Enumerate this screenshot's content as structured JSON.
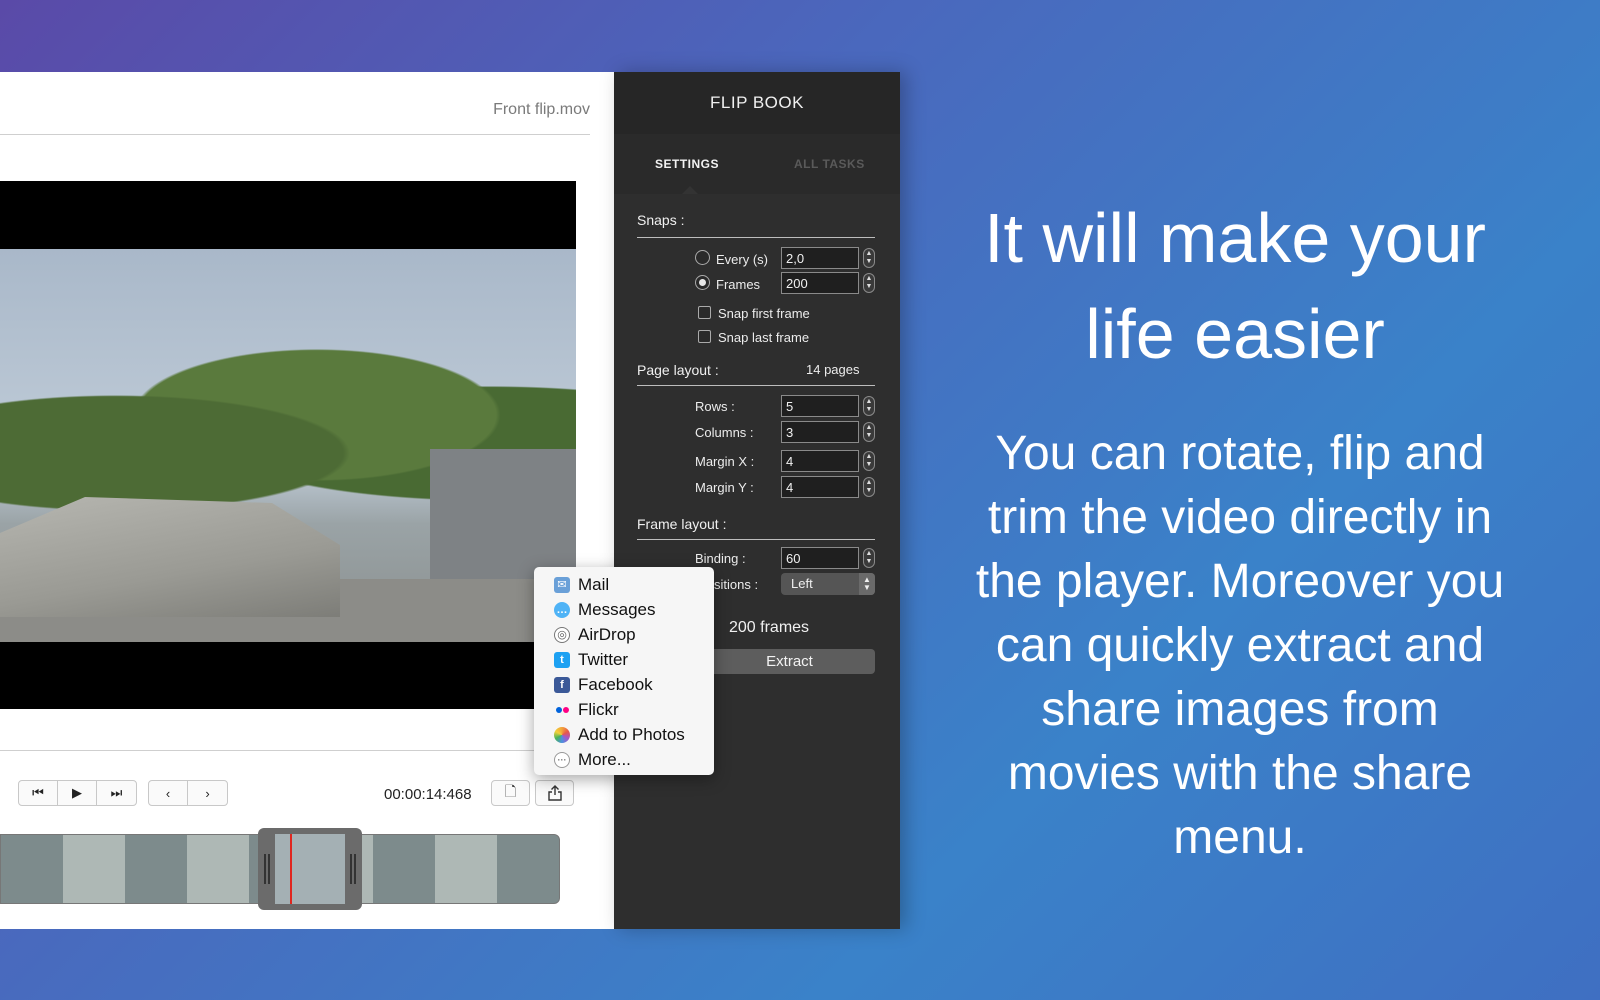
{
  "player": {
    "file_name": "Front flip.mov",
    "timecode": "00:00:14:468"
  },
  "share_menu": {
    "items": [
      {
        "label": "Mail",
        "icon": "mail-icon",
        "color": "#6aa0d8"
      },
      {
        "label": "Messages",
        "icon": "messages-icon",
        "color": "#4fb3f6"
      },
      {
        "label": "AirDrop",
        "icon": "airdrop-icon",
        "color": "#777777"
      },
      {
        "label": "Twitter",
        "icon": "twitter-icon",
        "color": "#1da1f2"
      },
      {
        "label": "Facebook",
        "icon": "facebook-icon",
        "color": "#3b5998"
      },
      {
        "label": "Flickr",
        "icon": "flickr-icon",
        "color": "#ff0084"
      },
      {
        "label": "Add to Photos",
        "icon": "photos-icon",
        "color": "#f2a33a"
      },
      {
        "label": "More...",
        "icon": "more-icon",
        "color": "#999999"
      }
    ]
  },
  "flipbook": {
    "title": "FLIP BOOK",
    "tabs": {
      "settings": "SETTINGS",
      "all_tasks": "ALL TASKS"
    },
    "snaps": {
      "label": "Snaps :",
      "every_label": "Every (s)",
      "every_value": "2,0",
      "frames_label": "Frames",
      "frames_value": "200",
      "snap_first": "Snap first frame",
      "snap_last": "Snap last frame"
    },
    "page_layout": {
      "label": "Page layout :",
      "pages": "14 pages",
      "rows_label": "Rows :",
      "rows": "5",
      "columns_label": "Columns :",
      "columns": "3",
      "margin_x_label": "Margin X :",
      "margin_x": "4",
      "margin_y_label": "Margin Y :",
      "margin_y": "4"
    },
    "frame_layout": {
      "label": "Frame layout :",
      "binding_label": "Binding :",
      "binding": "60",
      "positions_label": "sitions :",
      "positions": "Left"
    },
    "frames_count": "200 frames",
    "extract": "Extract"
  },
  "marketing": {
    "headline_line1": "It will make your",
    "headline_line2": "life easier",
    "body": "You can rotate, flip and trim the video directly in the player. Moreover you can quickly extract and share images from movies with the share menu."
  },
  "colors": {
    "panel_dark": "#2e2e2e",
    "playhead": "#e0261f",
    "background_start": "#5a4aa8",
    "background_end": "#3a82c9"
  }
}
